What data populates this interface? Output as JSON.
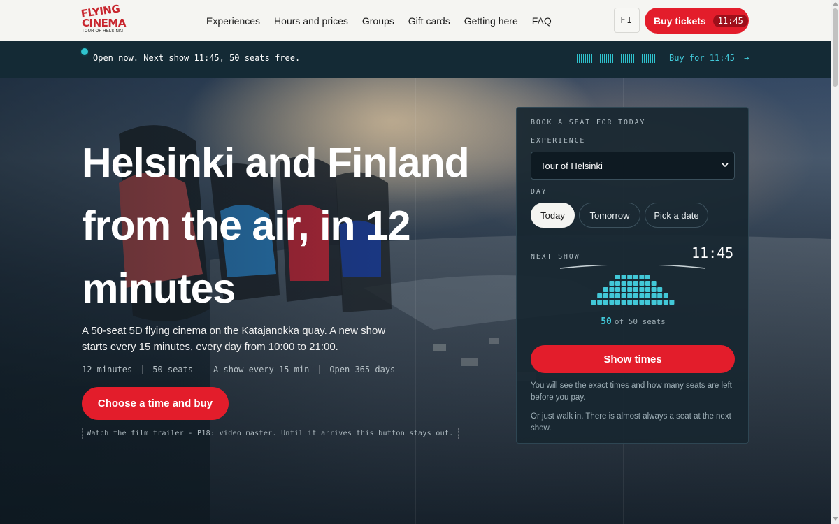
{
  "logo": {
    "line1": "FLYING",
    "line2": "CINEMA",
    "tagline": "TOUR OF HELSINKI"
  },
  "nav": {
    "links": [
      "Experiences",
      "Hours and prices",
      "Groups",
      "Gift cards",
      "Getting here",
      "FAQ"
    ],
    "lang": "FI",
    "buy_label": "Buy tickets",
    "buy_time": "11:45"
  },
  "status": {
    "text": "Open now. Next show 11:45, 50 seats free.",
    "buy_link": "Buy for 11:45",
    "arrow": "→"
  },
  "hero": {
    "title": "Helsinki and Finland from the air, in 12 minutes",
    "description": "A 50-seat 5D flying cinema on the Katajanokka quay. A new show starts every 15 minutes, every day from 10:00 to 21:00.",
    "facts": [
      "12 minutes",
      "50 seats",
      "A show every 15 min",
      "Open 365 days"
    ],
    "cta": "Choose a time and buy",
    "trailer_note": "Watch the film trailer - P18: video master. Until it arrives this button stays out."
  },
  "booking": {
    "heading": "BOOK A SEAT FOR TODAY",
    "experience_label": "EXPERIENCE",
    "experience_value": "Tour of Helsinki",
    "day_label": "DAY",
    "days": [
      "Today",
      "Tomorrow",
      "Pick a date"
    ],
    "selected_day": "Today",
    "next_show_label": "NEXT SHOW",
    "next_show_time": "11:45",
    "seats_free": "50",
    "seats_total_text": "of 50 seats",
    "show_times_button": "Show times",
    "note1": "You will see the exact times and how many seats are left before you pay.",
    "note2": "Or just walk in. There is almost always a seat at the next show."
  },
  "colors": {
    "accent": "#e31d2b",
    "teal": "#42c8d8",
    "panel": "#172630",
    "nav_bg": "#f5f5f2"
  },
  "icons": {
    "select": "chevron-down-icon",
    "status": "live-dot-icon",
    "arrow": "arrow-right-icon"
  }
}
